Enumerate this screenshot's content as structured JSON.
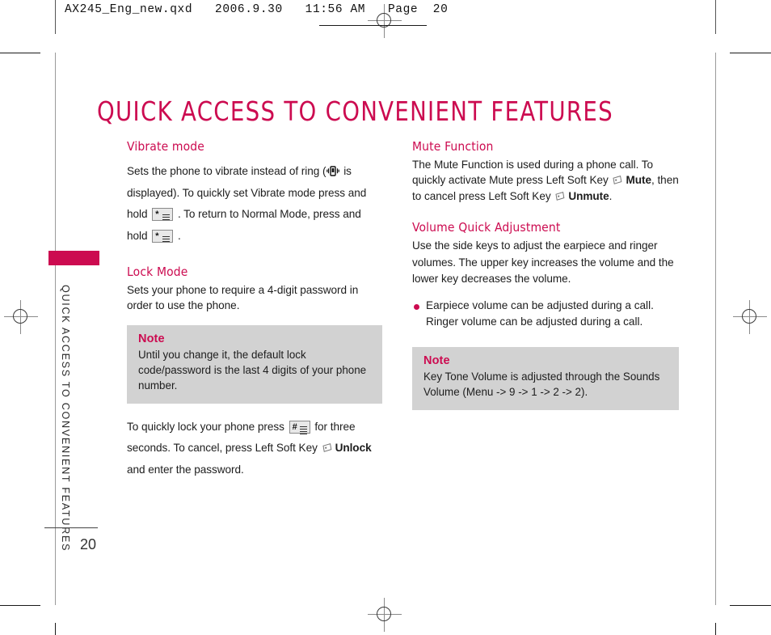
{
  "document": {
    "header_line": "AX245_Eng_new.qxd   2006.9.30   11:56 AM   Page  20",
    "page_title": "QUICK ACCESS TO CONVENIENT FEATURES",
    "page_number": "20",
    "sidebar_running_head": "QUICK ACCESS TO CONVENIENT FEATURES"
  },
  "colors": {
    "accent": "#CC0B50",
    "note_background": "#D2D2D2",
    "body_text": "#1D1D1D"
  },
  "left_column": {
    "vibrate": {
      "heading": "Vibrate mode",
      "text_1": "Sets the phone to vibrate instead of ring (",
      "text_2": " is displayed). To quickly set Vibrate mode press and hold ",
      "text_3": " . To return to Normal Mode, press and hold ",
      "text_4": " .",
      "icon_vibrate": "vibrate-icon",
      "key_star": "star-key-icon"
    },
    "lock": {
      "heading": "Lock Mode",
      "text": "Sets your phone to require a 4-digit password in order to use the phone.",
      "note": {
        "title": "Note",
        "body": "Until you change it, the default lock code/password is the last 4 digits of your phone number."
      },
      "instruction_1": "To quickly lock your phone press ",
      "instruction_2": " for three seconds. To cancel, press Left Soft Key ",
      "instruction_softkey_label": "Unlock",
      "instruction_3": " and enter the password.",
      "key_hash": "hash-key-icon",
      "icon_softkey": "left-soft-key-icon"
    }
  },
  "right_column": {
    "mute": {
      "heading": "Mute Function",
      "text_1": "The Mute Function is used during a phone call. To quickly activate Mute press Left Soft Key ",
      "label_mute": "Mute",
      "text_2": ", then to cancel press Left Soft Key ",
      "label_unmute": "Unmute",
      "text_3": ".",
      "icon_softkey": "left-soft-key-icon"
    },
    "volume": {
      "heading": "Volume Quick Adjustment",
      "text": "Use the side keys to adjust the earpiece and ringer volumes. The upper key increases the volume and the lower key decreases the volume.",
      "bullet": "Earpiece volume can be adjusted during a call. Ringer volume can be adjusted during a call.",
      "note": {
        "title": "Note",
        "body": "Key Tone Volume is adjusted through the Sounds Volume (Menu -> 9 -> 1 -> 2 -> 2)."
      }
    }
  }
}
